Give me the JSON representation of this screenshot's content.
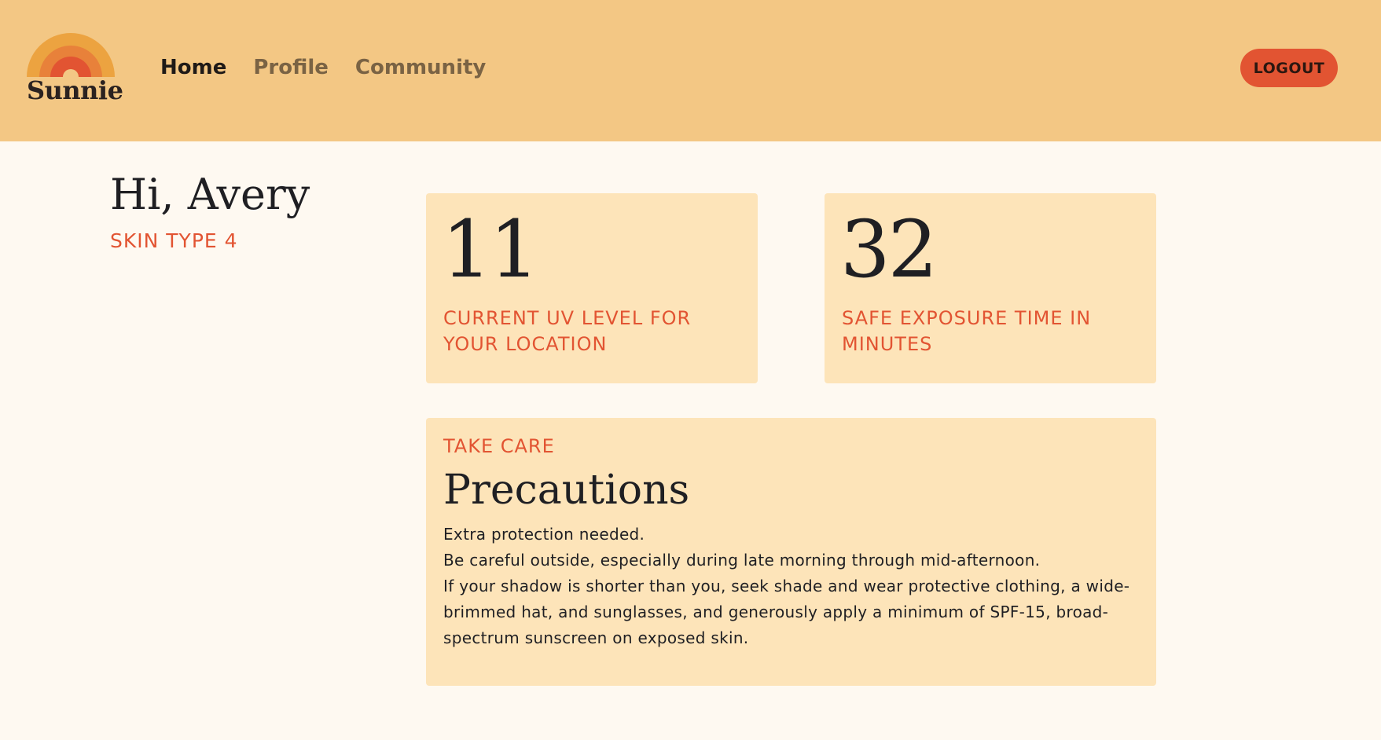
{
  "brand": {
    "name": "Sunnie",
    "logo_icon": "sun-rainbow-icon",
    "colors": {
      "header_bg": "#f3c784",
      "page_bg": "#fef9f1",
      "card_bg": "#fde4b9",
      "accent": "#e25432",
      "logo_outer": "#eca340",
      "logo_inner": "#e25432"
    }
  },
  "nav": {
    "items": [
      {
        "label": "Home",
        "active": true
      },
      {
        "label": "Profile",
        "active": false
      },
      {
        "label": "Community",
        "active": false
      }
    ]
  },
  "header": {
    "logout_label": "LOGOUT"
  },
  "user": {
    "greeting": "Hi, Avery",
    "skin_type": "SKIN TYPE 4"
  },
  "stats": {
    "uv": {
      "value": "11",
      "label": "CURRENT UV LEVEL FOR YOUR LOCATION"
    },
    "exposure": {
      "value": "32",
      "label": "SAFE EXPOSURE TIME IN MINUTES"
    }
  },
  "precautions": {
    "eyebrow": "TAKE CARE",
    "title": "Precautions",
    "lines": [
      "Extra protection needed.",
      "Be careful outside, especially during late morning through mid-afternoon.",
      "If your shadow is shorter than you, seek shade and wear protective clothing, a wide-brimmed hat, and sunglasses, and generously apply a minimum of  SPF-15, broad-spectrum sunscreen on exposed skin."
    ]
  }
}
